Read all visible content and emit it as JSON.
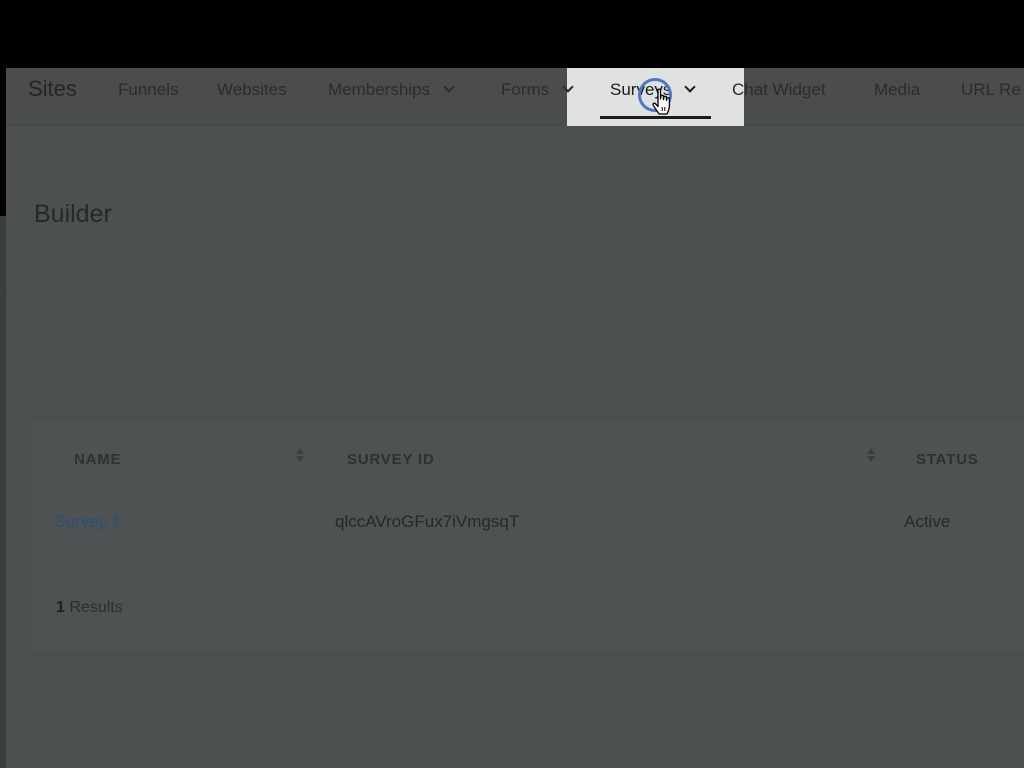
{
  "topnav": {
    "brand": "Sites",
    "items": [
      {
        "label": "Funnels"
      },
      {
        "label": "Websites"
      },
      {
        "label": "Memberships"
      },
      {
        "label": "Forms"
      },
      {
        "label": "Surveys"
      },
      {
        "label": "Chat Widget"
      },
      {
        "label": "Media"
      },
      {
        "label": "URL Re"
      }
    ],
    "active": "Surveys"
  },
  "header": {
    "title": "Builder"
  },
  "table": {
    "columns": [
      "NAME",
      "SURVEY ID",
      "STATUS"
    ],
    "rows": [
      {
        "name": "Survey 1",
        "survey_id": "qlccAVroGFux7iVmgsqT",
        "status": "Active"
      }
    ]
  },
  "footer": {
    "results_count": "1",
    "results_label": "Results"
  },
  "colors": {
    "link": "#2a4e82",
    "active_tab_bg": "#e0e1e1",
    "click_ring": "#4b78c9"
  }
}
